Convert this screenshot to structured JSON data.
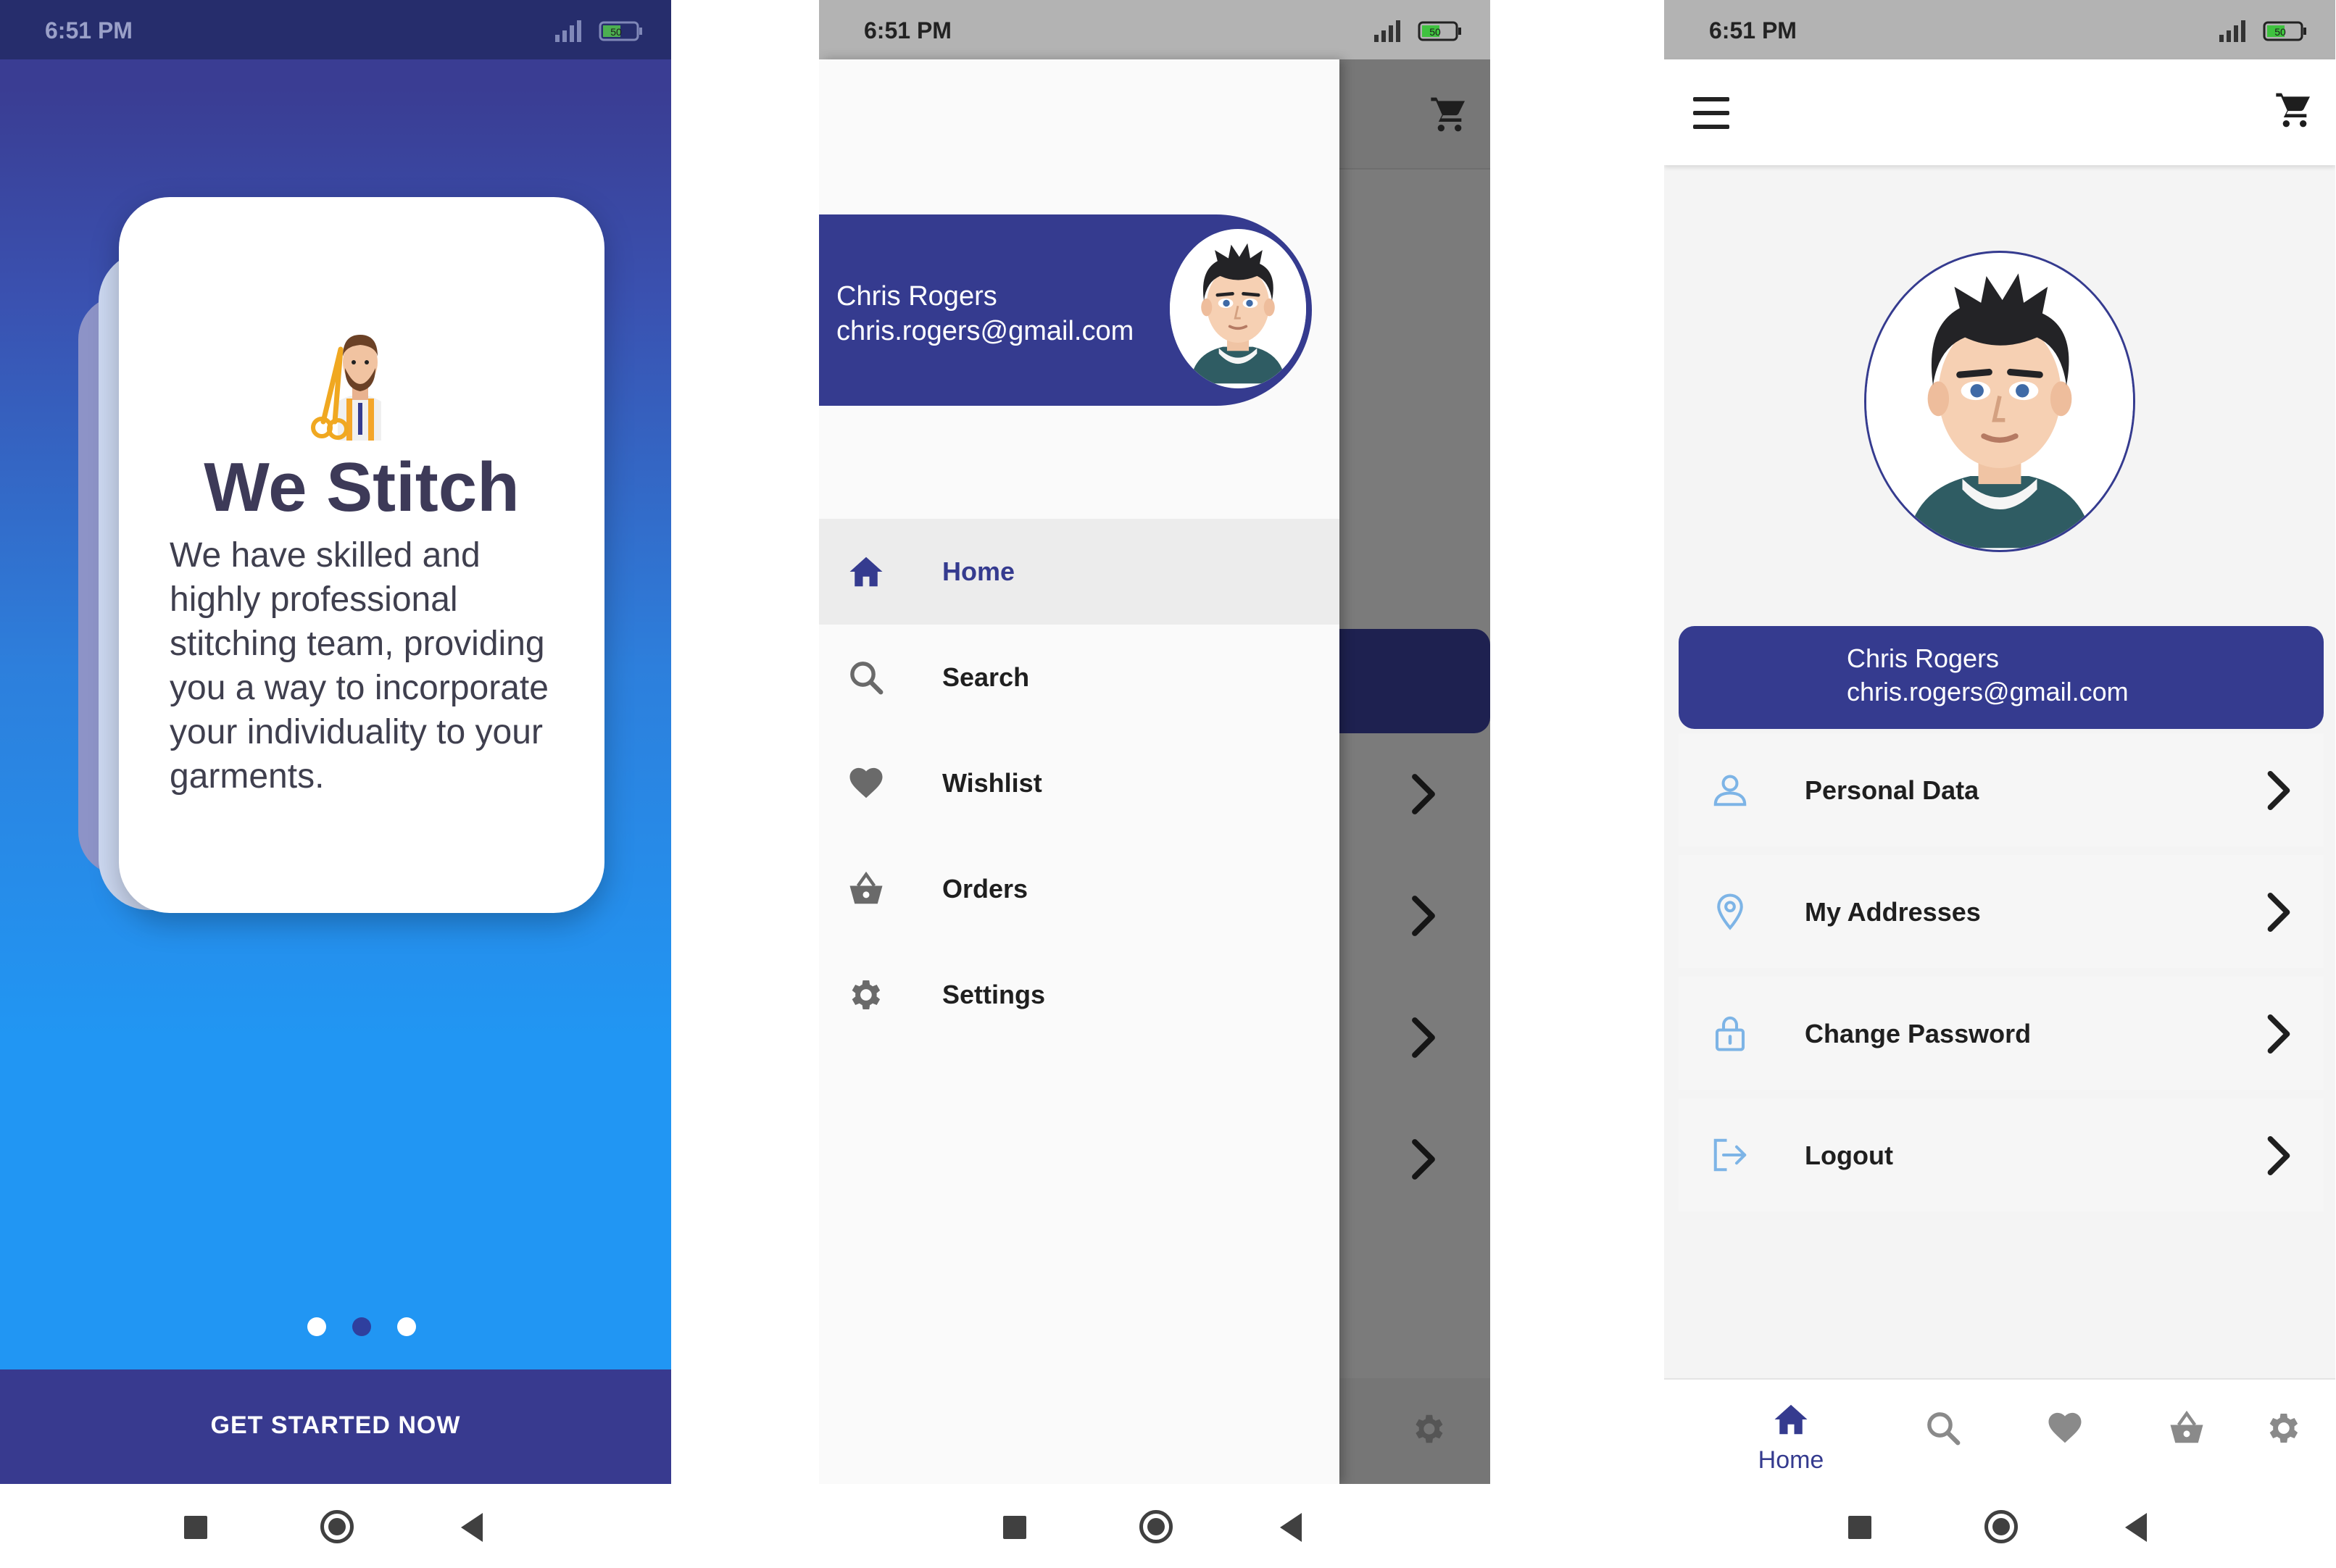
{
  "status_bar": {
    "time": "6:51 PM",
    "battery": "50"
  },
  "onboarding": {
    "title": "We Stitch",
    "body": "We have skilled and highly professional stitching team, providing you a way to incorporate your individuality to your garments.",
    "cta_label": "GET STARTED NOW",
    "pages": 3,
    "active_page": 2,
    "colors": {
      "primary": "#353b8f",
      "accent": "#2196f3"
    }
  },
  "drawer": {
    "user": {
      "name": "Chris Rogers",
      "email": "chris.rogers@gmail.com"
    },
    "items": [
      {
        "label": "Home",
        "icon": "home-icon",
        "active": true
      },
      {
        "label": "Search",
        "icon": "search-icon",
        "active": false
      },
      {
        "label": "Wishlist",
        "icon": "heart-icon",
        "active": false
      },
      {
        "label": "Orders",
        "icon": "basket-icon",
        "active": false
      },
      {
        "label": "Settings",
        "icon": "gear-icon",
        "active": false
      }
    ]
  },
  "profile": {
    "user": {
      "name": "Chris Rogers",
      "email": "chris.rogers@gmail.com"
    },
    "menu": [
      {
        "label": "Personal Data",
        "icon": "user-icon"
      },
      {
        "label": "My Addresses",
        "icon": "location-pin-icon"
      },
      {
        "label": "Change Password",
        "icon": "lock-icon"
      },
      {
        "label": "Logout",
        "icon": "logout-icon"
      }
    ],
    "bottom_nav": [
      {
        "label": "Home",
        "icon": "home-icon",
        "active": true
      },
      {
        "icon": "search-icon",
        "active": false
      },
      {
        "icon": "heart-icon",
        "active": false
      },
      {
        "icon": "basket-icon",
        "active": false
      },
      {
        "icon": "gear-icon",
        "active": false
      }
    ]
  }
}
